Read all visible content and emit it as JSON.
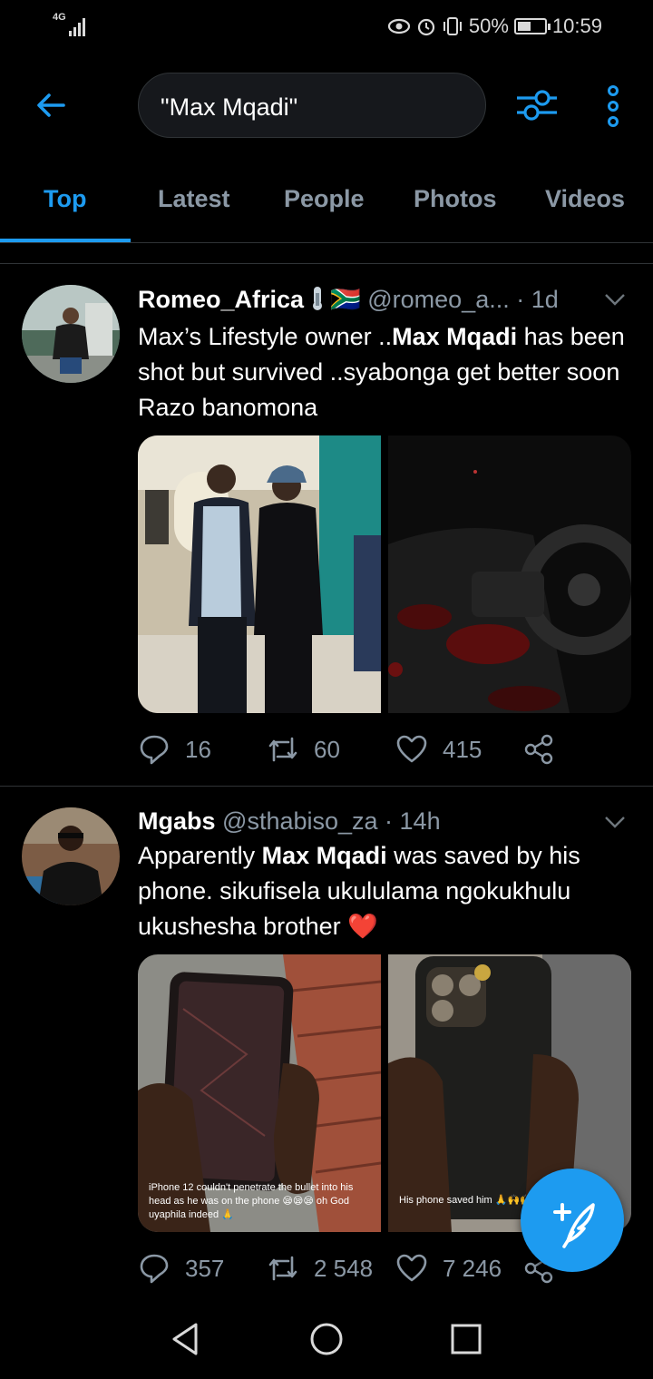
{
  "status_bar": {
    "network": "4G",
    "battery": "50%",
    "battery_level": 0.5,
    "time": "10:59"
  },
  "search": {
    "query": "\"Max Mqadi\""
  },
  "tabs": [
    "Top",
    "Latest",
    "People",
    "Photos",
    "Videos"
  ],
  "active_tab": "Top",
  "tweets": [
    {
      "display_name": "Romeo_Africa",
      "name_suffix": "🇿🇦",
      "handle_time": "@romeo_a... · 1d",
      "text_pre": "Max’s Lifestyle owner ..",
      "text_bold": "Max Mqadi",
      "text_post": " has been shot but survived ..syabonga get better soon Razo banomona",
      "replies": "16",
      "retweets": "60",
      "likes": "415"
    },
    {
      "display_name": "Mgabs",
      "handle_time": "@sthabiso_za · 14h",
      "text_pre": "Apparently ",
      "text_bold": "Max Mqadi",
      "text_post": " was saved by his phone. sikufisela ukululama ngokukhulu ukushesha brother ❤️",
      "caption_left": "iPhone 12 couldn't penetrate the bullet into his head as he was on the phone 😪😪😪 oh God uyaphila indeed 🙏",
      "caption_right": "His phone saved him 🙏🙌🙌",
      "replies": "357",
      "retweets": "2 548",
      "likes": "7 246"
    }
  ],
  "colors": {
    "accent": "#1d9bf0",
    "muted": "#8b98a5",
    "divider": "#2f3336"
  }
}
